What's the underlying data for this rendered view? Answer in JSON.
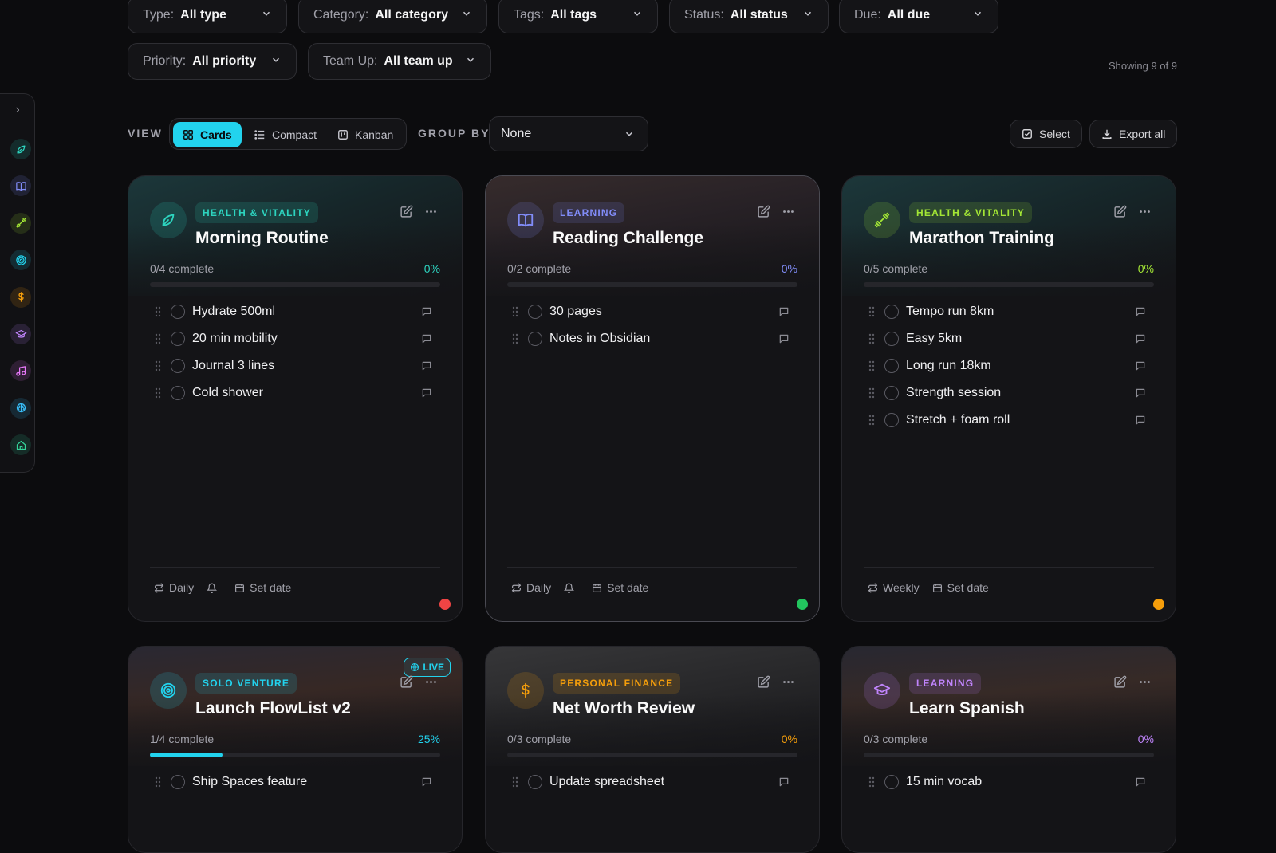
{
  "filters": [
    {
      "key": "Type:",
      "value": "All type"
    },
    {
      "key": "Category:",
      "value": "All category"
    },
    {
      "key": "Tags:",
      "value": "All tags"
    },
    {
      "key": "Status:",
      "value": "All status"
    },
    {
      "key": "Due:",
      "value": "All due"
    },
    {
      "key": "Priority:",
      "value": "All priority"
    },
    {
      "key": "Team Up:",
      "value": "All team up"
    }
  ],
  "showing": "Showing 9 of 9",
  "toolbar": {
    "view_label": "VIEW",
    "views": [
      {
        "label": "Cards",
        "icon": "grid-icon",
        "active": true
      },
      {
        "label": "Compact",
        "icon": "list-icon",
        "active": false
      },
      {
        "label": "Kanban",
        "icon": "kanban-icon",
        "active": false
      }
    ],
    "group_label": "GROUP BY",
    "group_value": "None",
    "select_label": "Select",
    "export_label": "Export all"
  },
  "sidebar": {
    "icons": [
      {
        "name": "leaf-icon",
        "color": "#2dd4bf"
      },
      {
        "name": "book-icon",
        "color": "#818cf8"
      },
      {
        "name": "dumbbell-icon",
        "color": "#a3e635"
      },
      {
        "name": "target-icon",
        "color": "#22d3ee"
      },
      {
        "name": "dollar-icon",
        "color": "#f59e0b"
      },
      {
        "name": "grad-cap-icon",
        "color": "#c084fc"
      },
      {
        "name": "music-icon",
        "color": "#e879f9"
      },
      {
        "name": "brain-icon",
        "color": "#38bdf8"
      },
      {
        "name": "home-icon",
        "color": "#34d399"
      }
    ]
  },
  "cards": [
    {
      "tag": "HEALTH & VITALITY",
      "title": "Morning Routine",
      "icon": "leaf-icon",
      "accent": "#2dd4bf",
      "progress_text": "0/4 complete",
      "percent": "0%",
      "progress": 0,
      "items": [
        "Hydrate 500ml",
        "20 min mobility",
        "Journal 3 lines",
        "Cold shower"
      ],
      "repeat": "Daily",
      "bell": true,
      "date": "Set date",
      "status_color": "#ef4444"
    },
    {
      "tag": "LEARNING",
      "title": "Reading Challenge",
      "icon": "book-icon",
      "accent": "#818cf8",
      "progress_text": "0/2 complete",
      "percent": "0%",
      "progress": 0,
      "items": [
        "30 pages",
        "Notes in Obsidian"
      ],
      "repeat": "Daily",
      "bell": true,
      "date": "Set date",
      "status_color": "#22c55e"
    },
    {
      "tag": "HEALTH & VITALITY",
      "title": "Marathon Training",
      "icon": "dumbbell-icon",
      "accent": "#a3e635",
      "progress_text": "0/5 complete",
      "percent": "0%",
      "progress": 0,
      "items": [
        "Tempo run 8km",
        "Easy 5km",
        "Long run 18km",
        "Strength session",
        "Stretch + foam roll"
      ],
      "repeat": "Weekly",
      "bell": false,
      "date": "Set date",
      "status_color": "#f59e0b"
    },
    {
      "tag": "SOLO VENTURE",
      "title": "Launch FlowList v2",
      "icon": "target-icon",
      "accent": "#22d3ee",
      "progress_text": "1/4 complete",
      "percent": "25%",
      "progress": 0.25,
      "live": "LIVE",
      "items": [
        "Ship Spaces feature"
      ]
    },
    {
      "tag": "PERSONAL FINANCE",
      "title": "Net Worth Review",
      "icon": "dollar-icon",
      "accent": "#f59e0b",
      "progress_text": "0/3 complete",
      "percent": "0%",
      "progress": 0,
      "items": [
        "Update spreadsheet"
      ]
    },
    {
      "tag": "LEARNING",
      "title": "Learn Spanish",
      "icon": "grad-cap-icon",
      "accent": "#c084fc",
      "progress_text": "0/3 complete",
      "percent": "0%",
      "progress": 0,
      "items": [
        "15 min vocab"
      ]
    }
  ]
}
